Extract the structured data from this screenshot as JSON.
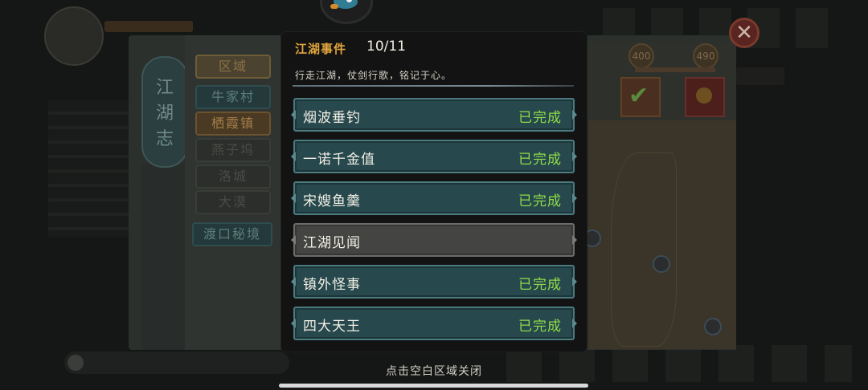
{
  "popup": {
    "title": "江湖事件",
    "count": "10/11",
    "description": "行走江湖，仗剑行歌，铭记于心。",
    "events": [
      {
        "name": "烟波垂钓",
        "status": "已完成"
      },
      {
        "name": "一诺千金值",
        "status": "已完成"
      },
      {
        "name": "宋嫂鱼羹",
        "status": "已完成"
      },
      {
        "name": "江湖见闻",
        "status": ""
      },
      {
        "name": "镇外怪事",
        "status": "已完成"
      },
      {
        "name": "四大天王",
        "status": "已完成"
      }
    ]
  },
  "book": {
    "spine_title": "江湖志",
    "region_label": "区域",
    "regions": [
      "牛家村",
      "栖霞镇",
      "燕子坞",
      "洛城",
      "大漠"
    ],
    "special_region": "渡口秘境",
    "stat_values": [
      "400",
      "490"
    ]
  },
  "close_hint": "点击空白区域关闭",
  "colors": {
    "title_accent": "#e2a63d",
    "completed_status": "#8fdb4a",
    "done_row_bg": "#27484c",
    "pending_row_bg": "#444543"
  },
  "icons": {
    "close": "close-icon",
    "check": "check-icon",
    "mascot": "fish-mascot-icon"
  }
}
